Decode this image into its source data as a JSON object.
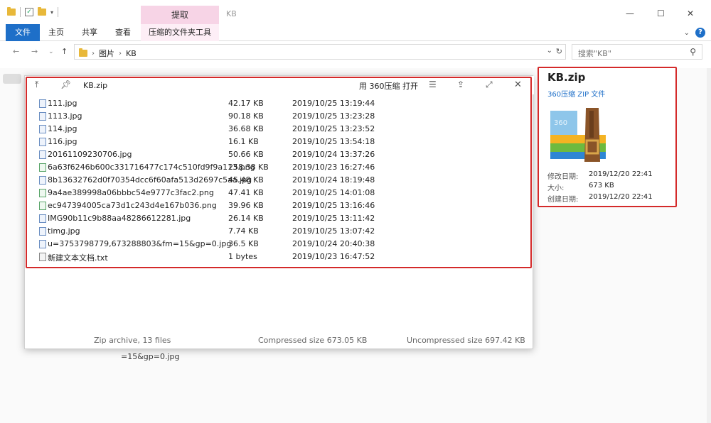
{
  "window": {
    "title": "KB",
    "context_tab": "提取",
    "ctrl_min": "—",
    "ctrl_max": "☐",
    "ctrl_close": "✕"
  },
  "ribbon": {
    "tabs": [
      "文件",
      "主页",
      "共享",
      "查看",
      "压缩的文件夹工具"
    ],
    "help": "?"
  },
  "address": {
    "crumbs": [
      "图片",
      "KB"
    ],
    "search_placeholder": "搜索\"KB\""
  },
  "preview": {
    "zip_name": "KB.zip",
    "open_with": "用 360压缩 打开",
    "files": [
      {
        "name": "111.jpg",
        "size": "42.17 KB",
        "date": "2019/10/25 13:19:44",
        "kind": "jpg"
      },
      {
        "name": "1113.jpg",
        "size": "90.18 KB",
        "date": "2019/10/25 13:23:28",
        "kind": "jpg"
      },
      {
        "name": "114.jpg",
        "size": "36.68 KB",
        "date": "2019/10/25 13:23:52",
        "kind": "jpg"
      },
      {
        "name": "116.jpg",
        "size": "16.1 KB",
        "date": "2019/10/25 13:54:18",
        "kind": "jpg"
      },
      {
        "name": "20161109230706.jpg",
        "size": "50.66 KB",
        "date": "2019/10/24 13:37:26",
        "kind": "jpg"
      },
      {
        "name": "6a63f6246b600c331716477c174c510fd9f9a113.png",
        "size": "258.38 KB",
        "date": "2019/10/23 16:27:46",
        "kind": "png"
      },
      {
        "name": "8b13632762d0f70354dcc6f60afa513d2697c5aa.jpg",
        "size": "45.48 KB",
        "date": "2019/10/24 18:19:48",
        "kind": "jpg"
      },
      {
        "name": "9a4ae389998a06bbbc54e9777c3fac2.png",
        "size": "47.41 KB",
        "date": "2019/10/25 14:01:08",
        "kind": "png"
      },
      {
        "name": "ec947394005ca73d1c243d4e167b036.png",
        "size": "39.96 KB",
        "date": "2019/10/25 13:16:46",
        "kind": "png"
      },
      {
        "name": "IMG90b11c9b88aa48286612281.jpg",
        "size": "26.14 KB",
        "date": "2019/10/25 13:11:42",
        "kind": "jpg"
      },
      {
        "name": "timg.jpg",
        "size": "7.74 KB",
        "date": "2019/10/25 13:07:42",
        "kind": "jpg"
      },
      {
        "name": "u=3753798779,673288803&fm=15&gp=0.jpg",
        "size": "36.5 KB",
        "date": "2019/10/24 20:40:38",
        "kind": "jpg"
      },
      {
        "name": "新建文本文档.txt",
        "size": "1 bytes",
        "date": "2019/10/23 16:47:52",
        "kind": "txt"
      }
    ],
    "footer_count": "Zip archive, 13 files",
    "footer_compressed": "Compressed size 673.05 KB",
    "footer_uncompressed": "Uncompressed size 697.42 KB"
  },
  "details": {
    "name": "KB.zip",
    "type": "360压缩 ZIP 文件",
    "modified_label": "修改日期:",
    "modified_value": "2019/12/20 22:41",
    "size_label": "大小:",
    "size_value": "673 KB",
    "created_label": "创建日期:",
    "created_value": "2019/12/20 22:41"
  },
  "background_caption": [
    "=15&gp=0.jpg"
  ],
  "colors": {
    "accent": "#1e6fc8",
    "highlight": "#d42a2a",
    "context_tab": "#f7d4e6"
  }
}
